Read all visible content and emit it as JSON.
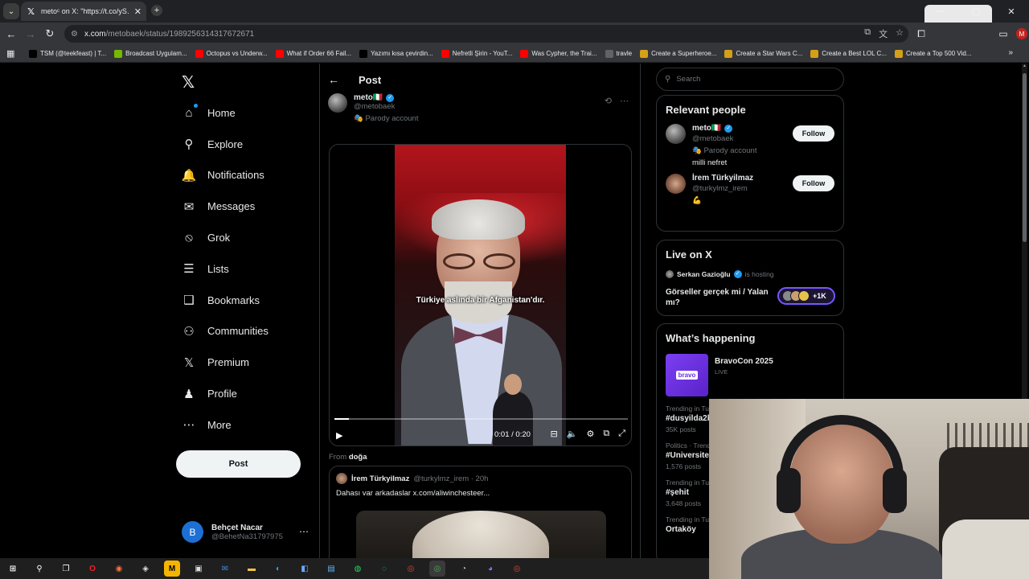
{
  "browser": {
    "tab_title": "metoᶜ on X: \"https://t.co/yS…",
    "url_domain": "x.com",
    "url_path": "/metobaek/status/1989256314317672671",
    "bookmarks": [
      {
        "label": "TSM (@teekfeast) | T...",
        "color": "#000000",
        "icon": "tiktok-icon"
      },
      {
        "label": "Broadcast Uygulam...",
        "color": "#76b900",
        "icon": "nvidia-icon"
      },
      {
        "label": "Octopus vs Underw...",
        "color": "#ff0000",
        "icon": "youtube-icon"
      },
      {
        "label": "What if Order 66 Fail...",
        "color": "#ff0000",
        "icon": "youtube-icon"
      },
      {
        "label": "Yazımı kısa çevirdin...",
        "color": "#000000",
        "icon": "tiktok-icon"
      },
      {
        "label": "Nefretli Şirin - YouT...",
        "color": "#ff0000",
        "icon": "youtube-icon"
      },
      {
        "label": "Was Cypher, the Trai...",
        "color": "#ff0000",
        "icon": "youtube-icon"
      },
      {
        "label": "travle",
        "color": "#5f6368",
        "icon": "globe-icon"
      },
      {
        "label": "Create a Superheroe...",
        "color": "#d4a017",
        "icon": "tiermaker-icon"
      },
      {
        "label": "Create a Star Wars C...",
        "color": "#d4a017",
        "icon": "tiermaker-icon"
      },
      {
        "label": "Create a Best LOL C...",
        "color": "#d4a017",
        "icon": "tiermaker-icon"
      },
      {
        "label": "Create a Top 500 Vid...",
        "color": "#d4a017",
        "icon": "tiermaker-icon"
      }
    ],
    "profile_letter": "M"
  },
  "nav": {
    "items": [
      {
        "label": "Home",
        "icon": "home-icon",
        "glyph": "⌂"
      },
      {
        "label": "Explore",
        "icon": "search-icon",
        "glyph": "⚲"
      },
      {
        "label": "Notifications",
        "icon": "bell-icon",
        "glyph": "🔔"
      },
      {
        "label": "Messages",
        "icon": "envelope-icon",
        "glyph": "✉"
      },
      {
        "label": "Grok",
        "icon": "grok-icon",
        "glyph": "⦸"
      },
      {
        "label": "Lists",
        "icon": "list-icon",
        "glyph": "☰"
      },
      {
        "label": "Bookmarks",
        "icon": "bookmark-icon",
        "glyph": "❑"
      },
      {
        "label": "Communities",
        "icon": "people-icon",
        "glyph": "⚇"
      },
      {
        "label": "Premium",
        "icon": "x-icon",
        "glyph": "𝕏"
      },
      {
        "label": "Profile",
        "icon": "person-icon",
        "glyph": "♟"
      },
      {
        "label": "More",
        "icon": "more-circle-icon",
        "glyph": "⋯"
      }
    ],
    "post_label": "Post"
  },
  "account": {
    "initial": "B",
    "name": "Behçet Nacar",
    "handle": "@BehetNa31797975"
  },
  "main": {
    "title": "Post",
    "author": {
      "name": "meto🇮🇹",
      "handle": "@metobaek",
      "label": "🎭 Parody account"
    },
    "video": {
      "subtitle": "Türkiye aslında bir Afganistan'dır.",
      "time": "0:01 / 0:20",
      "progress_fraction": 0.05
    },
    "from_label": "From",
    "from_name": "doğa",
    "quote": {
      "name": "İrem Türkyilmaz",
      "meta": "@turkylmz_irem · 20h",
      "text": "Dahası var arkadaslar  x.com/aliwinchesteer..."
    }
  },
  "right": {
    "search_placeholder": "Search",
    "relevant": {
      "title": "Relevant people",
      "people": [
        {
          "name": "meto🇮🇹",
          "handle": "@metobaek",
          "line": "🎭 Parody account",
          "bio": "milli nefret",
          "follow": "Follow",
          "verified": true
        },
        {
          "name": "İrem Türkyilmaz",
          "handle": "@turkylmz_irem",
          "line": "💪",
          "bio": "",
          "follow": "Follow",
          "verified": false
        }
      ]
    },
    "live": {
      "title": "Live on X",
      "host": "Serkan Gazioğlu",
      "host_tag": "is hosting",
      "space_title": "Görseller gerçek mi / Yalan mı?",
      "count": "+1K"
    },
    "happening": {
      "title": "What’s happening",
      "feature": {
        "name": "BravoCon 2025",
        "status": "LIVE",
        "thumb": "bravo"
      },
      "trends": [
        {
          "category": "Trending in Tu",
          "name": "#dusyilda2k",
          "count": "35K posts"
        },
        {
          "category": "Politics · Trend",
          "name": "#Universite",
          "count": "1,576 posts"
        },
        {
          "category": "Trending in Tu",
          "name": "#şehit",
          "count": "3,648 posts"
        },
        {
          "category": "Trending in Tu",
          "name": "Ortaköy",
          "count": ""
        }
      ]
    }
  },
  "colors": {
    "accent": "#1d9bf0",
    "background": "#000000",
    "border": "#2f3336",
    "live_pill": "#7856ff"
  }
}
